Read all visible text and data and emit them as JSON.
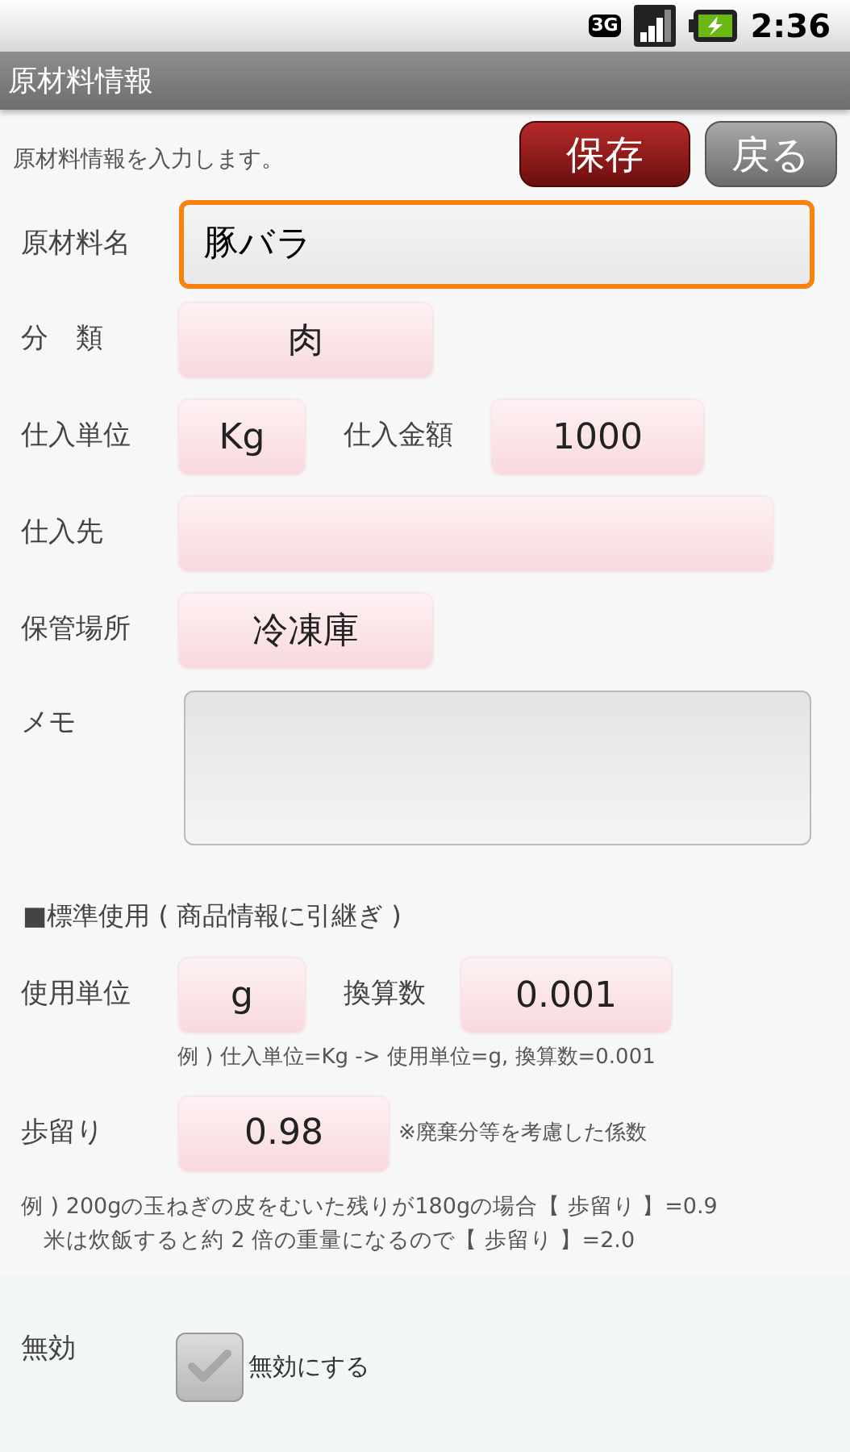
{
  "status_bar": {
    "network": "3G",
    "time": "2:36"
  },
  "title_bar": {
    "title": "原材料情報"
  },
  "header": {
    "description": "原材料情報を入力します。",
    "buttons": [
      {
        "label": "保存",
        "kind": "primary"
      },
      {
        "label": "戻る",
        "kind": "secondary"
      }
    ]
  },
  "name_field": {
    "label": "原材料名",
    "value": "豚バラ",
    "focused": true
  },
  "category": {
    "label": "分　類",
    "value": "肉"
  },
  "purchase": {
    "unit_label": "仕入単位",
    "unit": "Kg",
    "price_label": "仕入金額",
    "price": "1000"
  },
  "supplier": {
    "label": "仕入先"
  },
  "storage": {
    "label": "保管場所",
    "value": "冷凍庫"
  },
  "memo": {
    "label": "メモ"
  },
  "standard_usage": {
    "heading": "■標準使用 ( 商品情報に引継ぎ )",
    "unit_label": "使用単位",
    "unit": "g",
    "factor_label": "換算数",
    "factor": "0.001",
    "example": "例 ) 仕入単位=Kg -> 使用単位=g, 換算数=0.001",
    "yield_label": "歩留り",
    "yield": "0.98",
    "yield_note": "※廃棄分等を考慮した係数",
    "notes": [
      "例 ) 200gの玉ねぎの皮をむいた残りが180gの場合【 歩留り 】=0.9",
      "　米は炊飯すると約 2 倍の重量になるので【 歩留り 】=2.0"
    ]
  },
  "disabled_row": {
    "label": "無効",
    "checkbox_label": "無効にする",
    "checked": false
  }
}
